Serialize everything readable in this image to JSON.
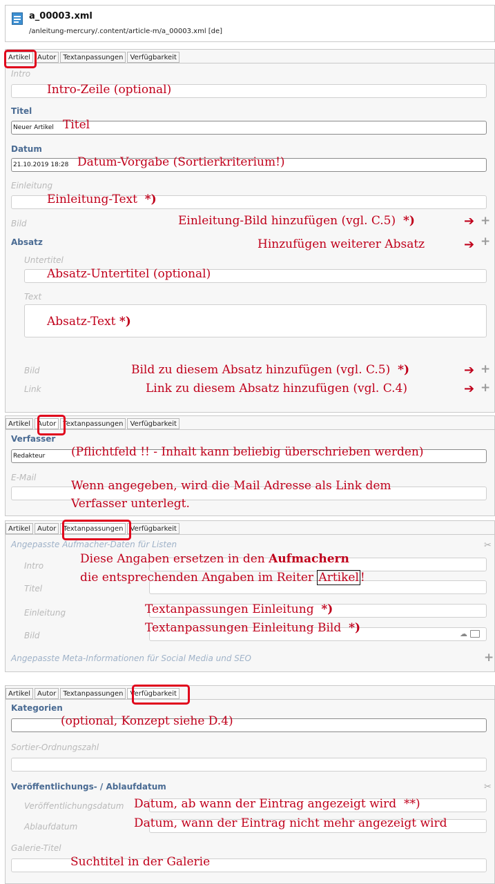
{
  "file": {
    "name": "a_00003.xml",
    "path": "/anleitung-mercury/.content/article-m/a_00003.xml [de]"
  },
  "tabs": [
    "Artikel",
    "Autor",
    "Textanpassungen",
    "Verfügbarkeit"
  ],
  "artikel": {
    "intro_label": "Intro",
    "intro_note": "Intro-Zeile (optional)",
    "titel_label": "Titel",
    "titel_value": "Neuer Artikel",
    "titel_note": "Titel",
    "datum_label": "Datum",
    "datum_value": "21.10.2019 18:28",
    "datum_note": "Datum-Vorgabe (Sortierkriterium!)",
    "einleitung_label": "Einleitung",
    "einleitung_note": "Einleitung-Text",
    "bild_label": "Bild",
    "bild_note": "Einleitung-Bild  hinzufügen (vgl. C.5)",
    "absatz_label": "Absatz",
    "absatz_note": "Hinzufügen weiterer Absatz",
    "untertitel_label": "Untertitel",
    "untertitel_note": "Absatz-Untertitel  (optional)",
    "text_label": "Text",
    "text_note": "Absatz-Text",
    "absatz_bild_label": "Bild",
    "absatz_bild_note": "Bild zu diesem Absatz hinzufügen (vgl. C.5)",
    "link_label": "Link",
    "link_note": "Link  zu diesem Absatz hinzufügen (vgl. C.4)"
  },
  "autor": {
    "verfasser_label": "Verfasser",
    "verfasser_value": "Redakteur",
    "verfasser_note": "(Pflichtfeld !! - Inhalt kann beliebig überschrieben werden)",
    "email_label": "E-Mail",
    "email_note_1": "Wenn angegeben, wird die Mail Adresse als Link dem",
    "email_note_2": "Verfasser unterlegt."
  },
  "textanpassungen": {
    "header": "Angepasste Aufmacher-Daten für Listen",
    "note_1_pre": "Diese Angaben ersetzen in den ",
    "note_1_bold": "Aufmachern",
    "note_2_pre": "die entsprechenden Angaben im Reiter ",
    "note_2_boxed": "Artikel",
    "note_2_post": "!",
    "intro_label": "Intro",
    "titel_label": "Titel",
    "einleitung_label": "Einleitung",
    "einleitung_note": "Textanpassungen Einleitung",
    "bild_label": "Bild",
    "bild_note": "Textanpassungen Einleitung Bild",
    "meta_header": "Angepasste Meta-Informationen für Social Media und SEO"
  },
  "verfuegbarkeit": {
    "kategorien_label": "Kategorien",
    "kategorien_note": "(optional, Konzept siehe D.4)",
    "sortier_label": "Sortier-Ordnungszahl",
    "datum_header": "Veröffentlichungs- / Ablaufdatum",
    "veroeff_label": "Veröffentlichungsdatum",
    "veroeff_note": "Datum, ab wann der Eintrag angezeigt wird",
    "veroeff_mark": "**)",
    "ablauf_label": "Ablaufdatum",
    "ablauf_note": "Datum, wann der Eintrag nicht mehr angezeigt wird",
    "galerie_label": "Galerie-Titel",
    "galerie_note": "Suchtitel in der Galerie"
  },
  "marks": {
    "star": "*)"
  },
  "icons": [
    "file-icon",
    "plus-icon",
    "arrow-right-icon",
    "scissors-icon",
    "upload-icon",
    "folder-icon"
  ]
}
